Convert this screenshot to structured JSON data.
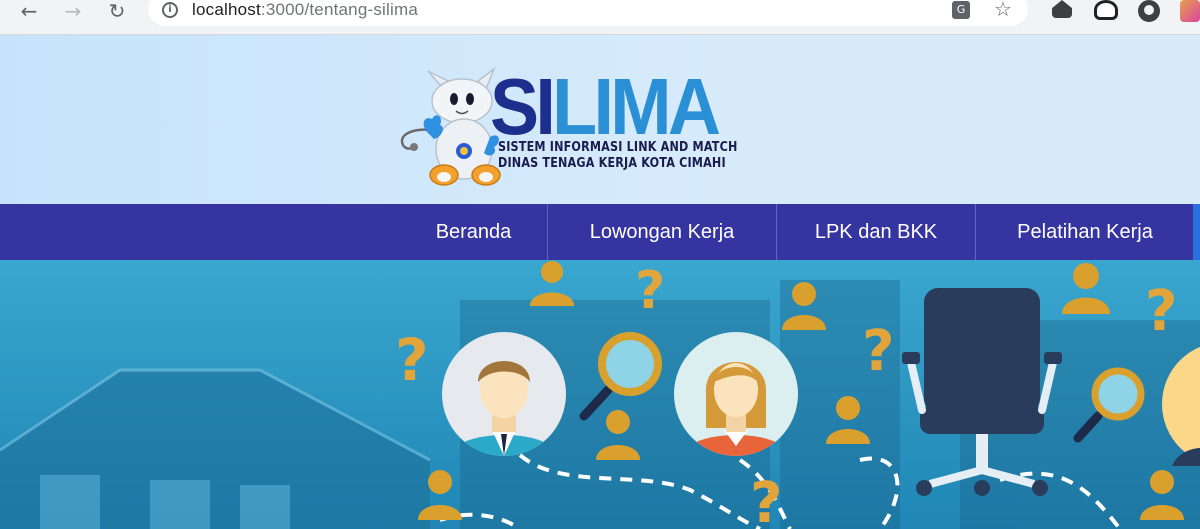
{
  "browser": {
    "url_host": "localhost",
    "url_rest": ":3000/tentang-silima"
  },
  "logo": {
    "brand_si": "SI",
    "brand_lima": "LIMA",
    "tagline_1": "SISTEM INFORMASI LINK AND MATCH",
    "tagline_2": "DINAS TENAGA KERJA KOTA CIMAHI"
  },
  "nav": {
    "items": [
      {
        "label": "Beranda"
      },
      {
        "label": "Lowongan Kerja"
      },
      {
        "label": "LPK dan BKK"
      },
      {
        "label": "Pelatihan Kerja"
      }
    ]
  },
  "colors": {
    "nav_bg": "#3634a0",
    "header_bg": "#cfe7fb",
    "hero_bg": "#2c9ec8",
    "accent_orange": "#e2a53b",
    "brand_dark": "#1c2f8c",
    "brand_light": "#2b8fd6"
  },
  "icons": [
    "back-arrow-icon",
    "forward-arrow-icon",
    "reload-icon",
    "info-icon",
    "translate-icon",
    "star-icon",
    "extension-icon"
  ]
}
